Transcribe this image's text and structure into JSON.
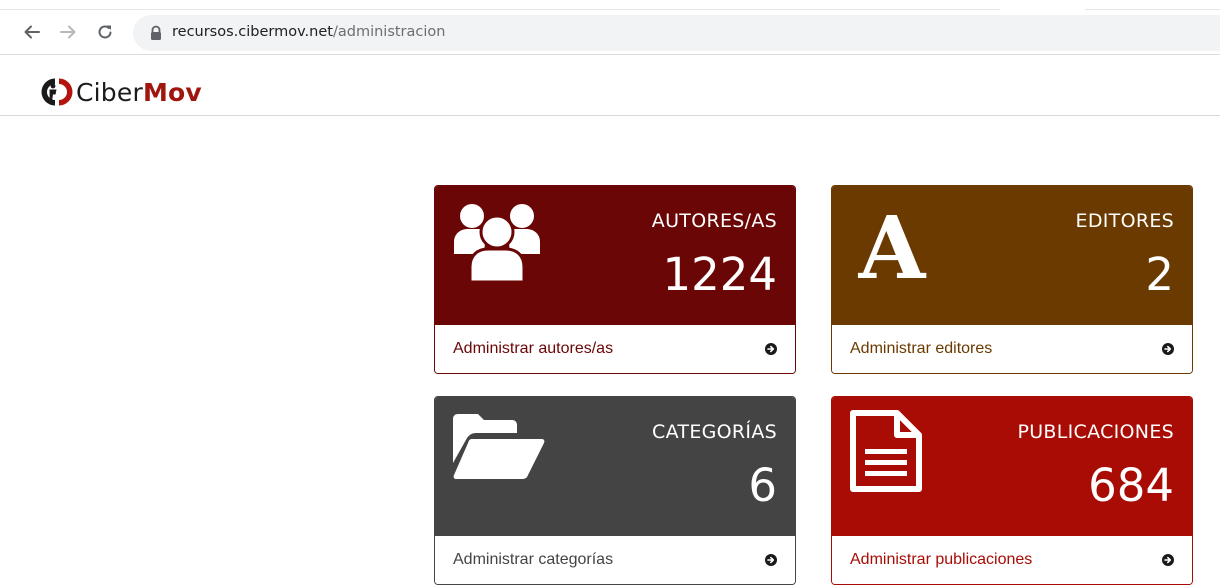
{
  "browser": {
    "url_host": "recursos.cibermov.net",
    "url_path": "/administracion"
  },
  "site": {
    "logo_text_light": "Ciber",
    "logo_text_bold": "Mov"
  },
  "colors": {
    "autores": "#6b0606",
    "editores": "#6b3a00",
    "categorias": "#444444",
    "publicaciones": "#a80c05"
  },
  "cards": {
    "autores": {
      "icon": "users-icon",
      "title": "AUTORES/AS",
      "count": "1224",
      "link": "Administrar autores/as"
    },
    "editores": {
      "icon": "letter-a-icon",
      "title": "EDITORES",
      "count": "2",
      "link": "Administrar editores"
    },
    "categorias": {
      "icon": "folder-open-icon",
      "title": "CATEGORÍAS",
      "count": "6",
      "link": "Administrar categorías"
    },
    "publicaciones": {
      "icon": "document-icon",
      "title": "PUBLICACIONES",
      "count": "684",
      "link": "Administrar publicaciones"
    }
  }
}
